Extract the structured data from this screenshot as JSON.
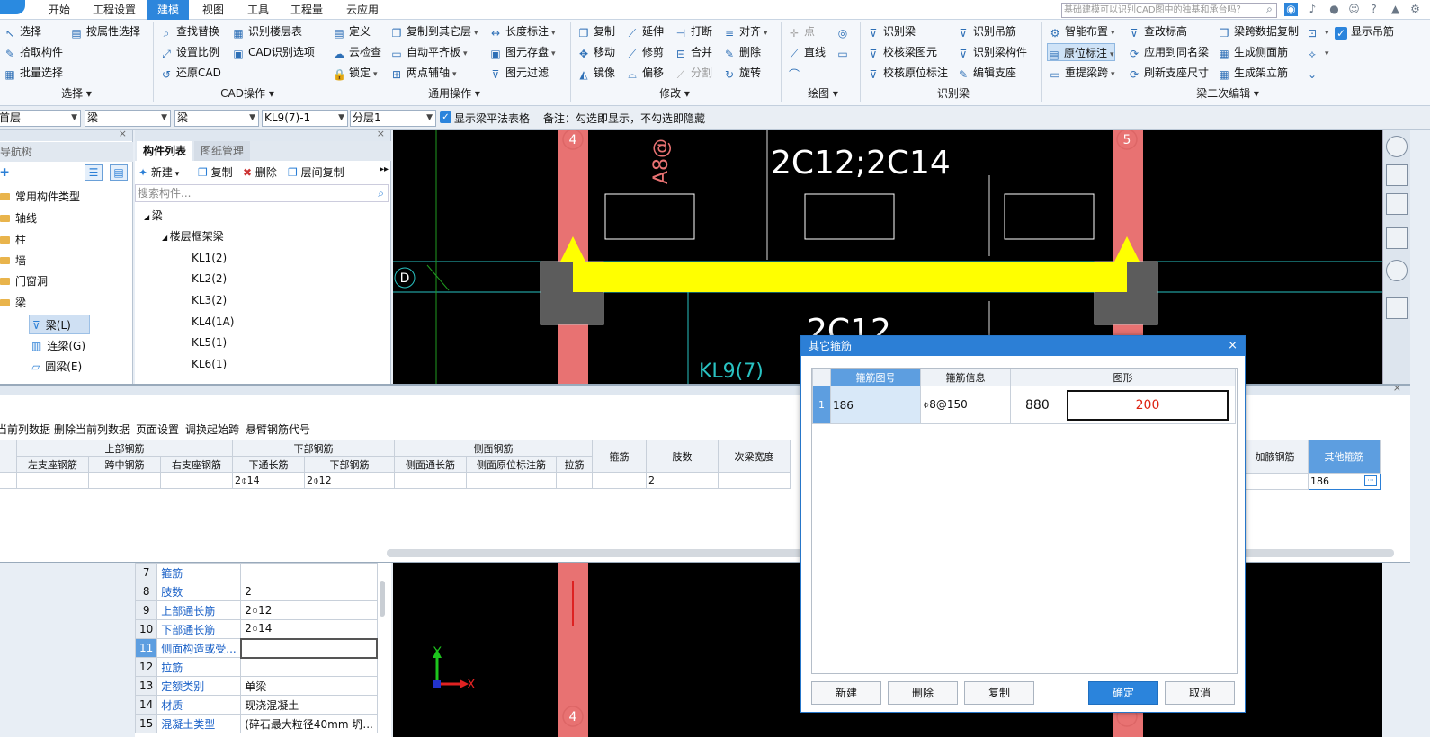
{
  "menu": {
    "tabs": [
      "开始",
      "工程设置",
      "建模",
      "视图",
      "工具",
      "工程量",
      "云应用"
    ],
    "active": "建模",
    "search_placeholder": "基础建模可以识别CAD图中的独基和承台吗？"
  },
  "ribbon": {
    "select": {
      "title": "选择",
      "items": [
        "选择",
        "按属性选择",
        "拾取构件",
        "批量选择"
      ]
    },
    "cad": {
      "title": "CAD操作",
      "items": [
        "查找替换",
        "识别楼层表",
        "设置比例",
        "CAD识别选项",
        "还原CAD"
      ]
    },
    "common": {
      "title": "通用操作",
      "items": [
        "定义",
        "复制到其它层",
        "长度标注",
        "云检查",
        "自动平齐板",
        "图元存盘",
        "锁定",
        "两点辅轴",
        "图元过滤"
      ]
    },
    "modify": {
      "title": "修改",
      "items": [
        "复制",
        "延伸",
        "打断",
        "对齐",
        "移动",
        "修剪",
        "合并",
        "删除",
        "镜像",
        "偏移",
        "分割",
        "旋转"
      ]
    },
    "draw": {
      "title": "绘图",
      "items": [
        "点",
        "直线"
      ]
    },
    "recog": {
      "title": "识别梁",
      "items": [
        "识别梁",
        "识别吊筋",
        "校核梁图元",
        "识别梁构件",
        "校核原位标注",
        "编辑支座"
      ]
    },
    "beam2": {
      "title": "梁二次编辑",
      "items": [
        "智能布置",
        "查改标高",
        "梁跨数据复制",
        "显示吊筋",
        "原位标注",
        "应用到同名梁",
        "生成侧面筋",
        "重提梁跨",
        "刷新支座尺寸",
        "生成架立筋"
      ]
    }
  },
  "propbar": {
    "floor": "首层",
    "type1": "梁",
    "type2": "梁",
    "component": "KL9(7)-1",
    "layer": "分层1",
    "show_table": "显示梁平法表格",
    "note": "备注：勾选即显示，不勾选即隐藏"
  },
  "navtree": {
    "title": "导航树",
    "items": [
      "常用构件类型",
      "轴线",
      "柱",
      "墙",
      "门窗洞",
      "梁"
    ],
    "children": [
      "梁(L)",
      "连梁(G)",
      "圆梁(E)"
    ]
  },
  "complist": {
    "tabs": [
      "构件列表",
      "图纸管理"
    ],
    "toolbar": [
      "新建",
      "复制",
      "删除",
      "层间复制"
    ],
    "search_placeholder": "搜索构件...",
    "root": "梁",
    "group": "楼层框架梁",
    "items": [
      "KL1(2)",
      "KL2(2)",
      "KL3(2)",
      "KL4(1A)",
      "KL5(1)",
      "KL6(1)"
    ]
  },
  "canvas": {
    "axis_top_left": "4",
    "axis_top_right": "5",
    "axis_row": "D",
    "text_upper": "2C12;2C14",
    "text_lower": "2C12",
    "text_beam": "KL9(7)",
    "text_a8": "A8@",
    "axis_x": "X",
    "axis_y": "Y"
  },
  "beamtable": {
    "toolbar": [
      "当前列数据",
      "删除当前列数据",
      "页面设置",
      "调换起始跨",
      "悬臂钢筋代号"
    ],
    "groups": [
      "上部钢筋",
      "下部钢筋",
      "侧面钢筋"
    ],
    "headers": [
      "左支座钢筋",
      "跨中钢筋",
      "右支座钢筋",
      "下通长筋",
      "下部钢筋",
      "侧面通长筋",
      "侧面原位标注筋",
      "拉筋",
      "箍筋",
      "肢数",
      "次梁宽度",
      "加腋钢筋",
      "其他箍筋"
    ],
    "row": {
      "bottom_through": "2⌽14",
      "bottom_bars": "2⌽12",
      "legs": "2",
      "other_stirrup": "186"
    }
  },
  "proptable": {
    "rows": [
      [
        "7",
        "箍筋",
        ""
      ],
      [
        "8",
        "肢数",
        "2"
      ],
      [
        "9",
        "上部通长筋",
        "2⌽12"
      ],
      [
        "10",
        "下部通长筋",
        "2⌽14"
      ],
      [
        "11",
        "侧面构造或受...",
        ""
      ],
      [
        "12",
        "拉筋",
        ""
      ],
      [
        "13",
        "定额类别",
        "单梁"
      ],
      [
        "14",
        "材质",
        "现浇混凝土"
      ],
      [
        "15",
        "混凝土类型",
        "(碎石最大粒径40mm 坍..."
      ]
    ]
  },
  "dialog": {
    "title": "其它箍筋",
    "headers": [
      "箍筋图号",
      "箍筋信息",
      "图形"
    ],
    "row": {
      "index": "1",
      "code": "186",
      "info": "⌽8@150",
      "dim1": "880",
      "dim2": "200"
    },
    "buttons": [
      "新建",
      "删除",
      "复制",
      "确定",
      "取消"
    ]
  },
  "colors": {
    "accent": "#2c7fd6",
    "beam_yellow": "#ffff00",
    "column_red": "#e87272"
  }
}
